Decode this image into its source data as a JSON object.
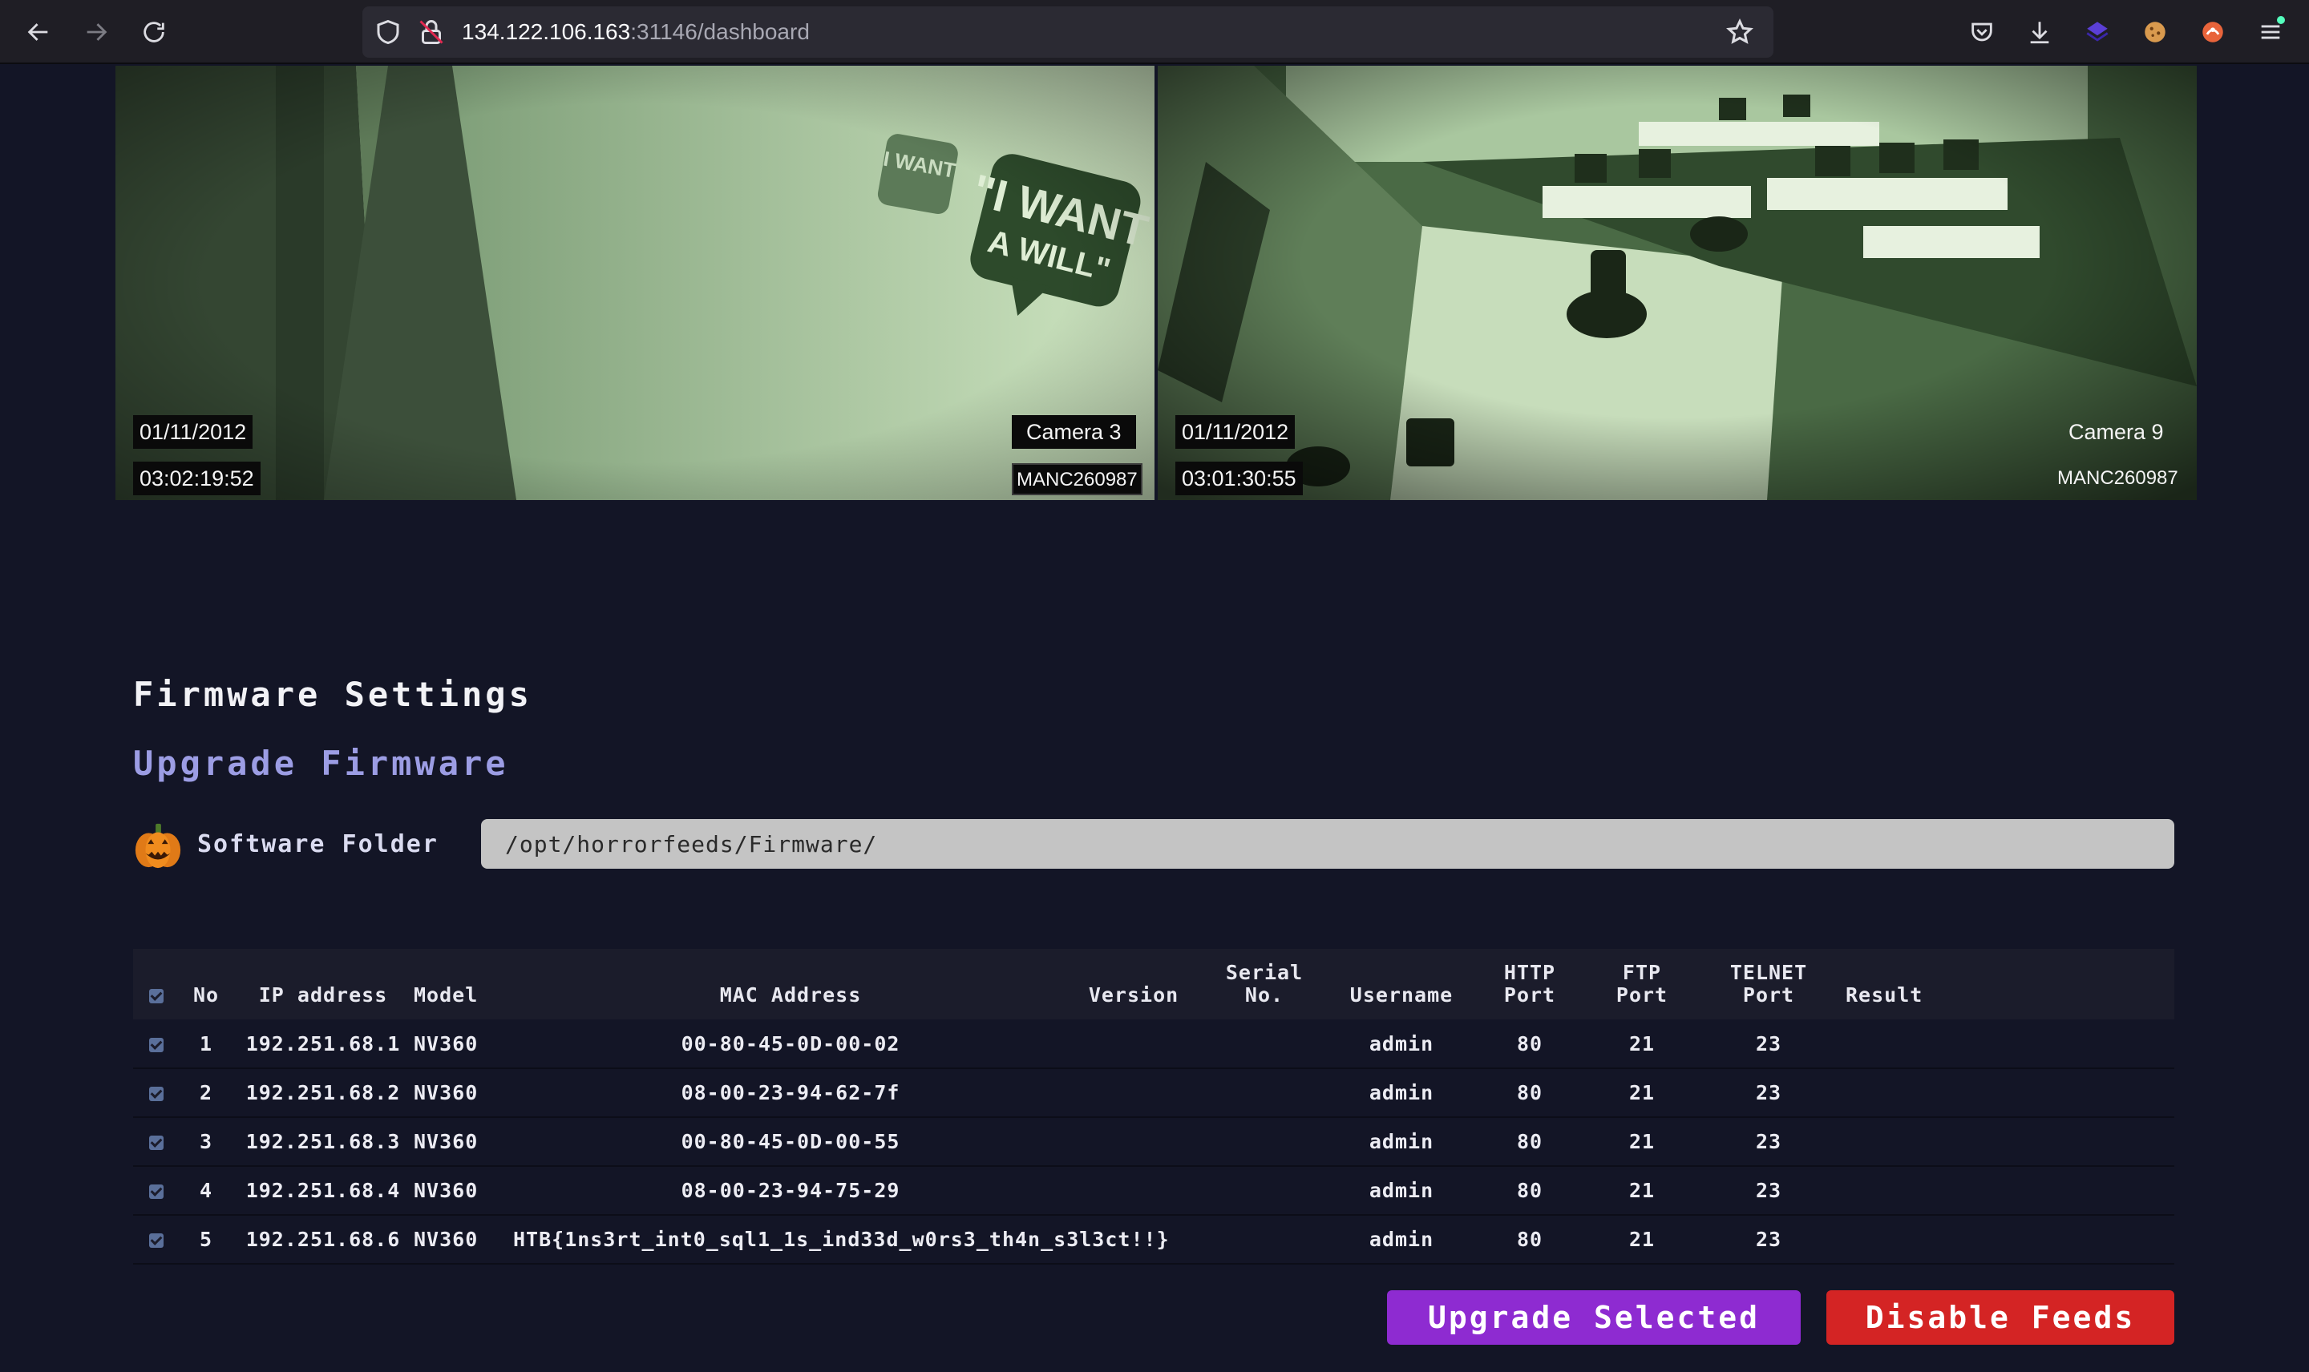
{
  "browser": {
    "url_host": "134.122.106.163",
    "url_rest": ":31146/dashboard"
  },
  "feeds": [
    {
      "date": "01/11/2012",
      "time": "03:02:19:52",
      "camera": "Camera 3",
      "id": "MANC260987"
    },
    {
      "date": "01/11/2012",
      "time": "03:01:30:55",
      "camera": "Camera 9",
      "id": "MANC260987"
    }
  ],
  "firmware": {
    "title": "Firmware Settings",
    "subtitle": "Upgrade Firmware",
    "folder_label": "Software Folder",
    "folder_value": "/opt/horrorfeeds/Firmware/"
  },
  "table": {
    "headers": {
      "no": "No",
      "ip": "IP address",
      "model": "Model",
      "mac": "MAC Address",
      "version": "Version",
      "serial_1": "Serial",
      "serial_2": "No.",
      "username": "Username",
      "http_1": "HTTP",
      "http_2": "Port",
      "ftp_1": "FTP",
      "ftp_2": "Port",
      "telnet_1": "TELNET",
      "telnet_2": "Port",
      "result": "Result"
    },
    "rows": [
      {
        "no": "1",
        "ip": "192.251.68.1",
        "model": "NV360",
        "mac": "00-80-45-0D-00-02",
        "version": "",
        "serial": "",
        "username": "admin",
        "http": "80",
        "ftp": "21",
        "telnet": "23",
        "result": ""
      },
      {
        "no": "2",
        "ip": "192.251.68.2",
        "model": "NV360",
        "mac": "08-00-23-94-62-7f",
        "version": "",
        "serial": "",
        "username": "admin",
        "http": "80",
        "ftp": "21",
        "telnet": "23",
        "result": ""
      },
      {
        "no": "3",
        "ip": "192.251.68.3",
        "model": "NV360",
        "mac": "00-80-45-0D-00-55",
        "version": "",
        "serial": "",
        "username": "admin",
        "http": "80",
        "ftp": "21",
        "telnet": "23",
        "result": ""
      },
      {
        "no": "4",
        "ip": "192.251.68.4",
        "model": "NV360",
        "mac": "08-00-23-94-75-29",
        "version": "",
        "serial": "",
        "username": "admin",
        "http": "80",
        "ftp": "21",
        "telnet": "23",
        "result": ""
      },
      {
        "no": "5",
        "ip": "192.251.68.6",
        "model": "NV360",
        "mac": "HTB{1ns3rt_int0_sql1_1s_ind33d_w0rs3_th4n_s3l3ct!!}",
        "version": "",
        "serial": "",
        "username": "admin",
        "http": "80",
        "ftp": "21",
        "telnet": "23",
        "result": ""
      }
    ]
  },
  "buttons": {
    "upgrade": "Upgrade Selected",
    "disable": "Disable Feeds"
  },
  "colors": {
    "page_bg": "#131526",
    "subtitle": "#9c9de4",
    "upgrade_btn": "#8e2bd1",
    "disable_btn": "#d42424"
  },
  "icons": [
    "back-arrow-icon",
    "forward-arrow-icon",
    "reload-icon",
    "shield-icon",
    "insecure-lock-icon",
    "star-icon",
    "pocket-icon",
    "download-icon",
    "extension-icon",
    "cookie-icon",
    "extension-icon",
    "menu-icon",
    "pumpkin-icon"
  ]
}
